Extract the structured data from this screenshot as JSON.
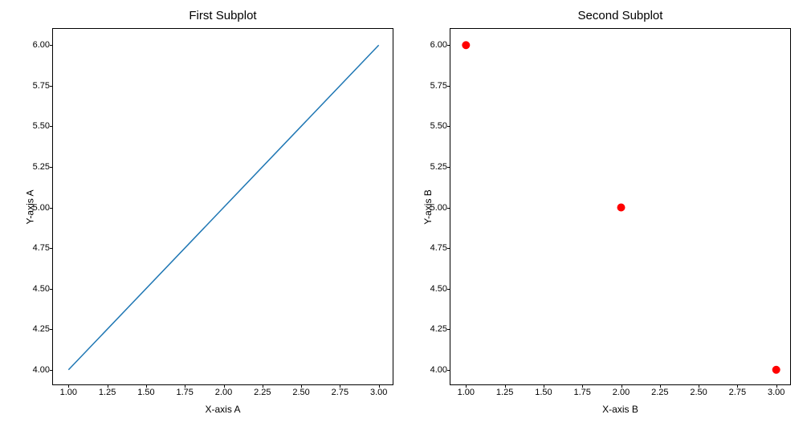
{
  "chart_data": [
    {
      "type": "line",
      "title": "First Subplot",
      "xlabel": "X-axis A",
      "ylabel": "Y-axis A",
      "x": [
        1,
        2,
        3
      ],
      "y": [
        4,
        5,
        6
      ],
      "xlim": [
        0.9,
        3.1
      ],
      "ylim": [
        3.9,
        6.1
      ],
      "xticks": [
        1.0,
        1.25,
        1.5,
        1.75,
        2.0,
        2.25,
        2.5,
        2.75,
        3.0
      ],
      "yticks": [
        4.0,
        4.25,
        4.5,
        4.75,
        5.0,
        5.25,
        5.5,
        5.75,
        6.0
      ],
      "color": "#1f77b4"
    },
    {
      "type": "scatter",
      "title": "Second Subplot",
      "xlabel": "X-axis B",
      "ylabel": "Y-axis B",
      "x": [
        1,
        2,
        3
      ],
      "y": [
        6,
        5,
        4
      ],
      "xlim": [
        0.9,
        3.1
      ],
      "ylim": [
        3.9,
        6.1
      ],
      "xticks": [
        1.0,
        1.25,
        1.5,
        1.75,
        2.0,
        2.25,
        2.5,
        2.75,
        3.0
      ],
      "yticks": [
        4.0,
        4.25,
        4.5,
        4.75,
        5.0,
        5.25,
        5.5,
        5.75,
        6.0
      ],
      "color": "red"
    }
  ]
}
